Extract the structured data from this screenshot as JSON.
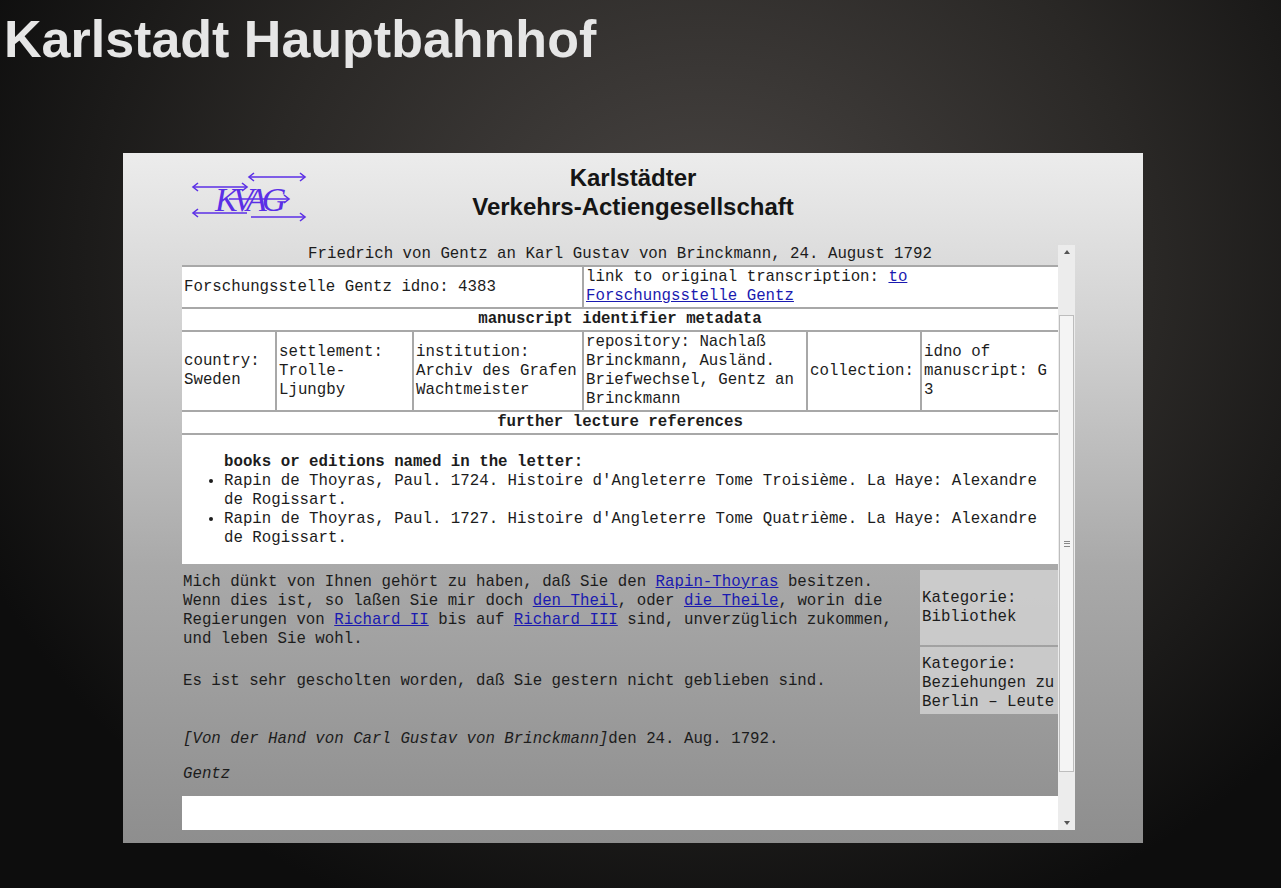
{
  "page": {
    "title": "Karlstadt Hauptbahnhof"
  },
  "header": {
    "logo": "KVAG",
    "title_lines": [
      "Karlstädter",
      "Verkehrs-Actiengesellschaft"
    ]
  },
  "letter": {
    "caption": "Friedrich von Gentz an Karl Gustav von Brinckmann, 24. August 1792",
    "idno": "Forschungsstelle Gentz idno: 4383",
    "link_label": "link to original transcription: ",
    "link_text": "to Forschungsstelle Gentz",
    "metadata_heading": "manuscript identifier metadata",
    "metadata": [
      "country: Sweden",
      "settlement: Trolle-Ljungby",
      "institution: Archiv des Grafen Wachtmeister",
      "repository: Nachlaß Brinckmann, Ausländ. Briefwechsel, Gentz an Brinckmann",
      "collection:",
      "idno of manuscript: G 3"
    ],
    "references_heading": "further lecture references",
    "books_heading": "books or editions named in the letter:",
    "books": [
      "Rapin de Thoyras, Paul. 1724. Histoire d'Angleterre Tome Troisième. La Haye: Alexandre de Rogissart.",
      "Rapin de Thoyras, Paul. 1727. Histoire d'Angleterre Tome Quatrième. La Haye: Alexandre de Rogissart."
    ],
    "paragraphs": [
      [
        {
          "text": "Mich dünkt von Ihnen gehört zu haben, daß Sie den ",
          "link": false
        },
        {
          "text": "Rapin-Thoyras",
          "link": true
        },
        {
          "text": " besitzen. Wenn dies ist, so laßen Sie mir doch ",
          "link": false
        },
        {
          "text": "den Theil",
          "link": true
        },
        {
          "text": ", oder ",
          "link": false
        },
        {
          "text": "die Theile",
          "link": true
        },
        {
          "text": ", worin die Regierungen von ",
          "link": false
        },
        {
          "text": "Richard II",
          "link": true
        },
        {
          "text": " bis auf ",
          "link": false
        },
        {
          "text": "Richard III",
          "link": true
        },
        {
          "text": " sind, unverzüglich zukommen, und leben Sie wohl.",
          "link": false
        }
      ],
      [
        {
          "text": "Es ist sehr gescholten worden, daß Sie gestern nicht geblieben sind.",
          "link": false
        }
      ]
    ],
    "categories": [
      "Kategorie: Bibliothek",
      "Kategorie: Beziehungen zu Berlin – Leute"
    ],
    "note": "[Von der Hand von Carl Gustav von Brinckmann]",
    "date": "den 24. Aug. 1792.",
    "signature": "Gentz"
  },
  "scrollbar": {
    "level": 0.56
  }
}
